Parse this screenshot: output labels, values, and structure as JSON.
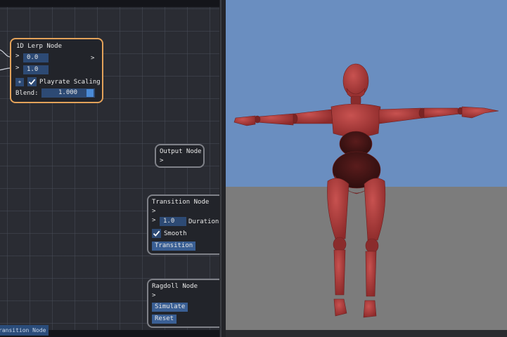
{
  "node_editor": {
    "lerp_node": {
      "title": "1D Lerp Node",
      "input_pin": ">",
      "output_pin": ">",
      "input_a": "0.0",
      "input_b": "1.0",
      "add_button": "+",
      "playrate_label": "Playrate Scaling",
      "playrate_checked": true,
      "blend_label": "Blend:",
      "blend_value": "1.000",
      "blend_fraction": 1.0
    },
    "output_node": {
      "title": "Output Node",
      "input_pin": ">"
    },
    "transition_node": {
      "title": "Transition Node",
      "input_pin_1": ">",
      "input_pin_2": ">",
      "duration_value": "1.0",
      "duration_label": "Duration",
      "smooth_label": "Smooth",
      "smooth_checked": true,
      "transition_button": "Transition"
    },
    "ragdoll_node": {
      "title": "Ragdoll Node",
      "input_pin": ">",
      "simulate_button": "Simulate",
      "reset_button": "Reset"
    },
    "bottom_tab": "ransition Node"
  },
  "viewport": {
    "sky_color": "#6a8ec0",
    "ground_color": "#7c7c7c",
    "character_color": "#b8403e"
  }
}
